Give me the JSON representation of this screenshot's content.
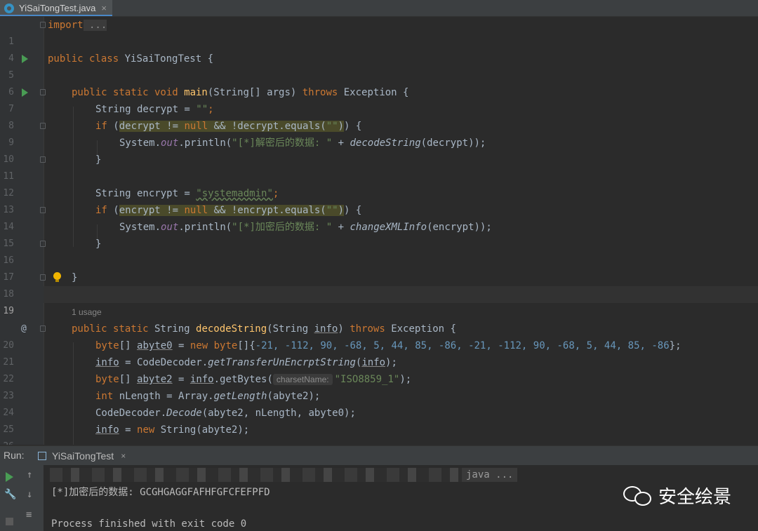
{
  "tab": {
    "filename": "YiSaiTongTest.java",
    "close": "×"
  },
  "editor": {
    "usage_hint": "1 usage",
    "param_hint": "charsetName:",
    "lines": [
      {
        "n": "1"
      },
      {
        "n": "4"
      },
      {
        "n": "5"
      },
      {
        "n": "6"
      },
      {
        "n": "7"
      },
      {
        "n": "8"
      },
      {
        "n": "9"
      },
      {
        "n": "10"
      },
      {
        "n": "11"
      },
      {
        "n": "12"
      },
      {
        "n": "13"
      },
      {
        "n": "14"
      },
      {
        "n": "15"
      },
      {
        "n": "16"
      },
      {
        "n": "17"
      },
      {
        "n": "18"
      },
      {
        "n": "19"
      },
      {
        "n": "20"
      },
      {
        "n": "21"
      },
      {
        "n": "22"
      },
      {
        "n": "23"
      },
      {
        "n": "24"
      },
      {
        "n": "25"
      },
      {
        "n": "26"
      }
    ],
    "code": {
      "l1_kw": "import",
      "l1_rest": " ...",
      "l5_kw": "public class",
      "l5_rest": " YiSaiTongTest {",
      "l7_kw1": "public static void",
      "l7_fn": " main",
      "l7_rest1": "(String[] args) ",
      "l7_kw2": "throws",
      "l7_rest2": " Exception {",
      "l8_rest": "String decrypt = ",
      "l8_str": "\"\"",
      "l8_end": ";",
      "l9_kw": "if",
      "l9_a": " (",
      "l9_hl1": "decrypt != ",
      "l9_null": "null",
      "l9_hl2": " && !decrypt.equals(",
      "l9_str": "\"\"",
      "l9_b": ")",
      "l9_end": ") {",
      "l10_a": "System.",
      "l10_out": "out",
      "l10_b": ".println(",
      "l10_str": "\"[*]解密后的数据: \"",
      "l10_c": " + ",
      "l10_fn": "decodeString",
      "l10_d": "(decrypt));",
      "l11": "}",
      "l13_rest": "String encrypt = ",
      "l13_str": "\"systemadmin\"",
      "l13_end": ";",
      "l14_kw": "if",
      "l14_a": " (",
      "l14_hl1": "encrypt != ",
      "l14_null": "null",
      "l14_hl2": " && !encrypt.equals(",
      "l14_str": "\"\"",
      "l14_b": ")",
      "l14_end": ") {",
      "l15_a": "System.",
      "l15_out": "out",
      "l15_b": ".println(",
      "l15_str": "\"[*]加密后的数据: \"",
      "l15_c": " + ",
      "l15_fn": "changeXMLInfo",
      "l15_d": "(encrypt));",
      "l16": "}",
      "l18": "}",
      "l20_kw1": "public static",
      "l20_a": " String ",
      "l20_fn": "decodeString",
      "l20_b": "(String ",
      "l20_info": "info",
      "l20_c": ") ",
      "l20_kw2": "throws",
      "l20_d": " Exception {",
      "l21_kw": "byte",
      "l21_a": "[] ",
      "l21_var": "abyte0",
      "l21_b": " = ",
      "l21_new": "new",
      "l21_c": " ",
      "l21_kw2": "byte",
      "l21_d": "[]{",
      "l21_nums": "-21, -112, 90, -68, 5, 44, 85, -86, -21, -112, 90, -68, 5, 44, 85, -86",
      "l21_end": "};",
      "l22_info": "info",
      "l22_a": " = CodeDecoder.",
      "l22_fn": "getTransferUnEncrptString",
      "l22_b": "(",
      "l22_info2": "info",
      "l22_c": ");",
      "l23_kw": "byte",
      "l23_a": "[] ",
      "l23_var": "abyte2",
      "l23_b": " = ",
      "l23_info": "info",
      "l23_c": ".getBytes(",
      "l23_str": "\"ISO8859_1\"",
      "l23_d": ");",
      "l24_kw": "int",
      "l24_a": " nLength = Array.",
      "l24_fn": "getLength",
      "l24_b": "(abyte2);",
      "l25_a": "CodeDecoder.",
      "l25_fn": "Decode",
      "l25_b": "(abyte2, nLength, abyte0);",
      "l26_info": "info",
      "l26_a": " = ",
      "l26_new": "new",
      "l26_b": " String(abyte2);"
    }
  },
  "run": {
    "label": "Run:",
    "tab_name": "YiSaiTongTest",
    "tab_close": "×",
    "cmd_tail": "java ...",
    "output_line": "[*]加密后的数据: GCGHGAGGFAFHFGFCFEFPFD",
    "exit_line": "Process finished with exit code 0"
  },
  "watermark": {
    "text": "安全绘景"
  },
  "colors": {
    "editor_bg": "#2b2b2b",
    "keyword": "#cc7832",
    "string": "#6a8759",
    "number": "#6897bb",
    "function": "#ffc66d",
    "field": "#9876aa",
    "text": "#a9b7c6"
  }
}
